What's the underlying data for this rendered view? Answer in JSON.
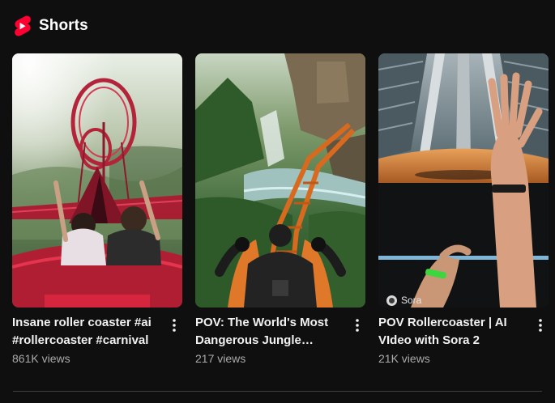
{
  "section": {
    "title": "Shorts",
    "icon": "youtube-shorts-icon",
    "brand_color": "#ff0033"
  },
  "shorts": [
    {
      "title": "Insane roller coaster #ai #rollercoaster #carnival",
      "views": "861K views",
      "more_icon": "more-vert-icon"
    },
    {
      "title": "POV: The World's Most Dangerous Jungle Rollercoaster",
      "views": "217 views",
      "more_icon": "more-vert-icon"
    },
    {
      "title": "POV Rollercoaster | AI VIdeo with Sora 2",
      "views": "21K views",
      "more_icon": "more-vert-icon",
      "watermark": "Sora"
    }
  ]
}
